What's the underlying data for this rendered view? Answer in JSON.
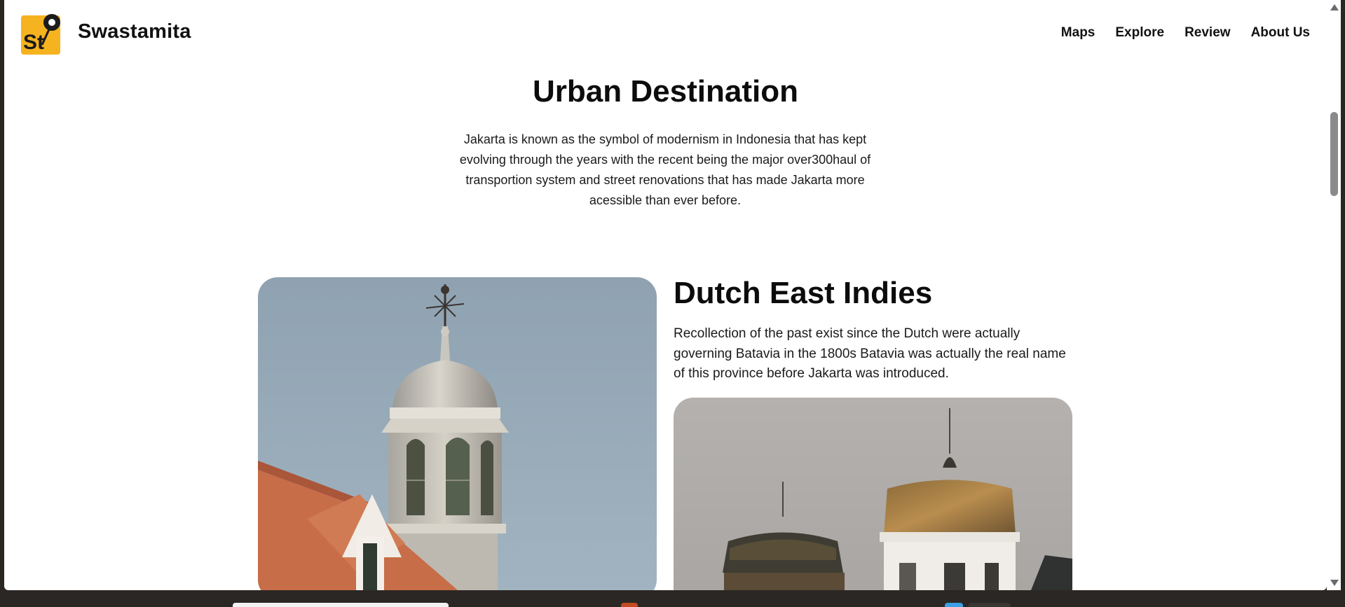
{
  "header": {
    "logo_text": "St",
    "brand": "Swastamita",
    "nav": [
      {
        "label": "Maps"
      },
      {
        "label": "Explore"
      },
      {
        "label": "Review"
      },
      {
        "label": "About Us"
      }
    ]
  },
  "intro": {
    "title": "Urban Destination",
    "description": "Jakarta is known as the symbol of modernism in Indonesia that has kept evolving through the years with the recent being the major over300haul of transportion system and street renovations that has made Jakarta more acessible than ever before."
  },
  "feature": {
    "title": "Dutch East Indies",
    "description": "Recollection of the past exist since the Dutch were actually governing Batavia in the 1800s Batavia was actually the real name of this province before Jakarta was introduced."
  },
  "colors": {
    "logo_bg": "#f6b320",
    "text": "#111111",
    "sky_left": "#94a7b6",
    "sky_right": "#b3b0ae",
    "roof": "#c9704b"
  }
}
